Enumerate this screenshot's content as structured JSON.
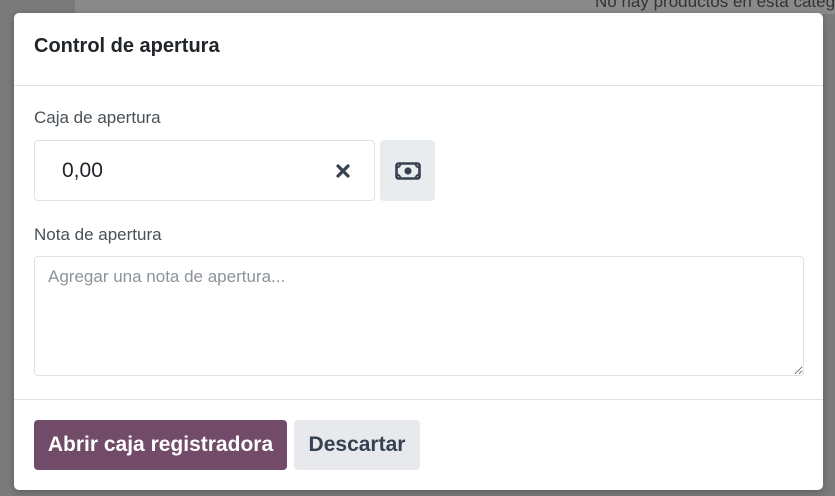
{
  "background": {
    "message": "No hay productos en esta categoría"
  },
  "modal": {
    "title": "Control de apertura",
    "cash_label": "Caja de apertura",
    "cash_value": "0,00",
    "clear_icon": "times-icon",
    "money_icon": "money-bill-icon",
    "note_label": "Nota de apertura",
    "note_placeholder": "Agregar una nota de apertura...",
    "open_button": "Abrir caja registradora",
    "discard_button": "Descartar"
  },
  "colors": {
    "primary": "#714b67",
    "secondary_bg": "#e7e9ed",
    "border": "#dee2e6"
  }
}
